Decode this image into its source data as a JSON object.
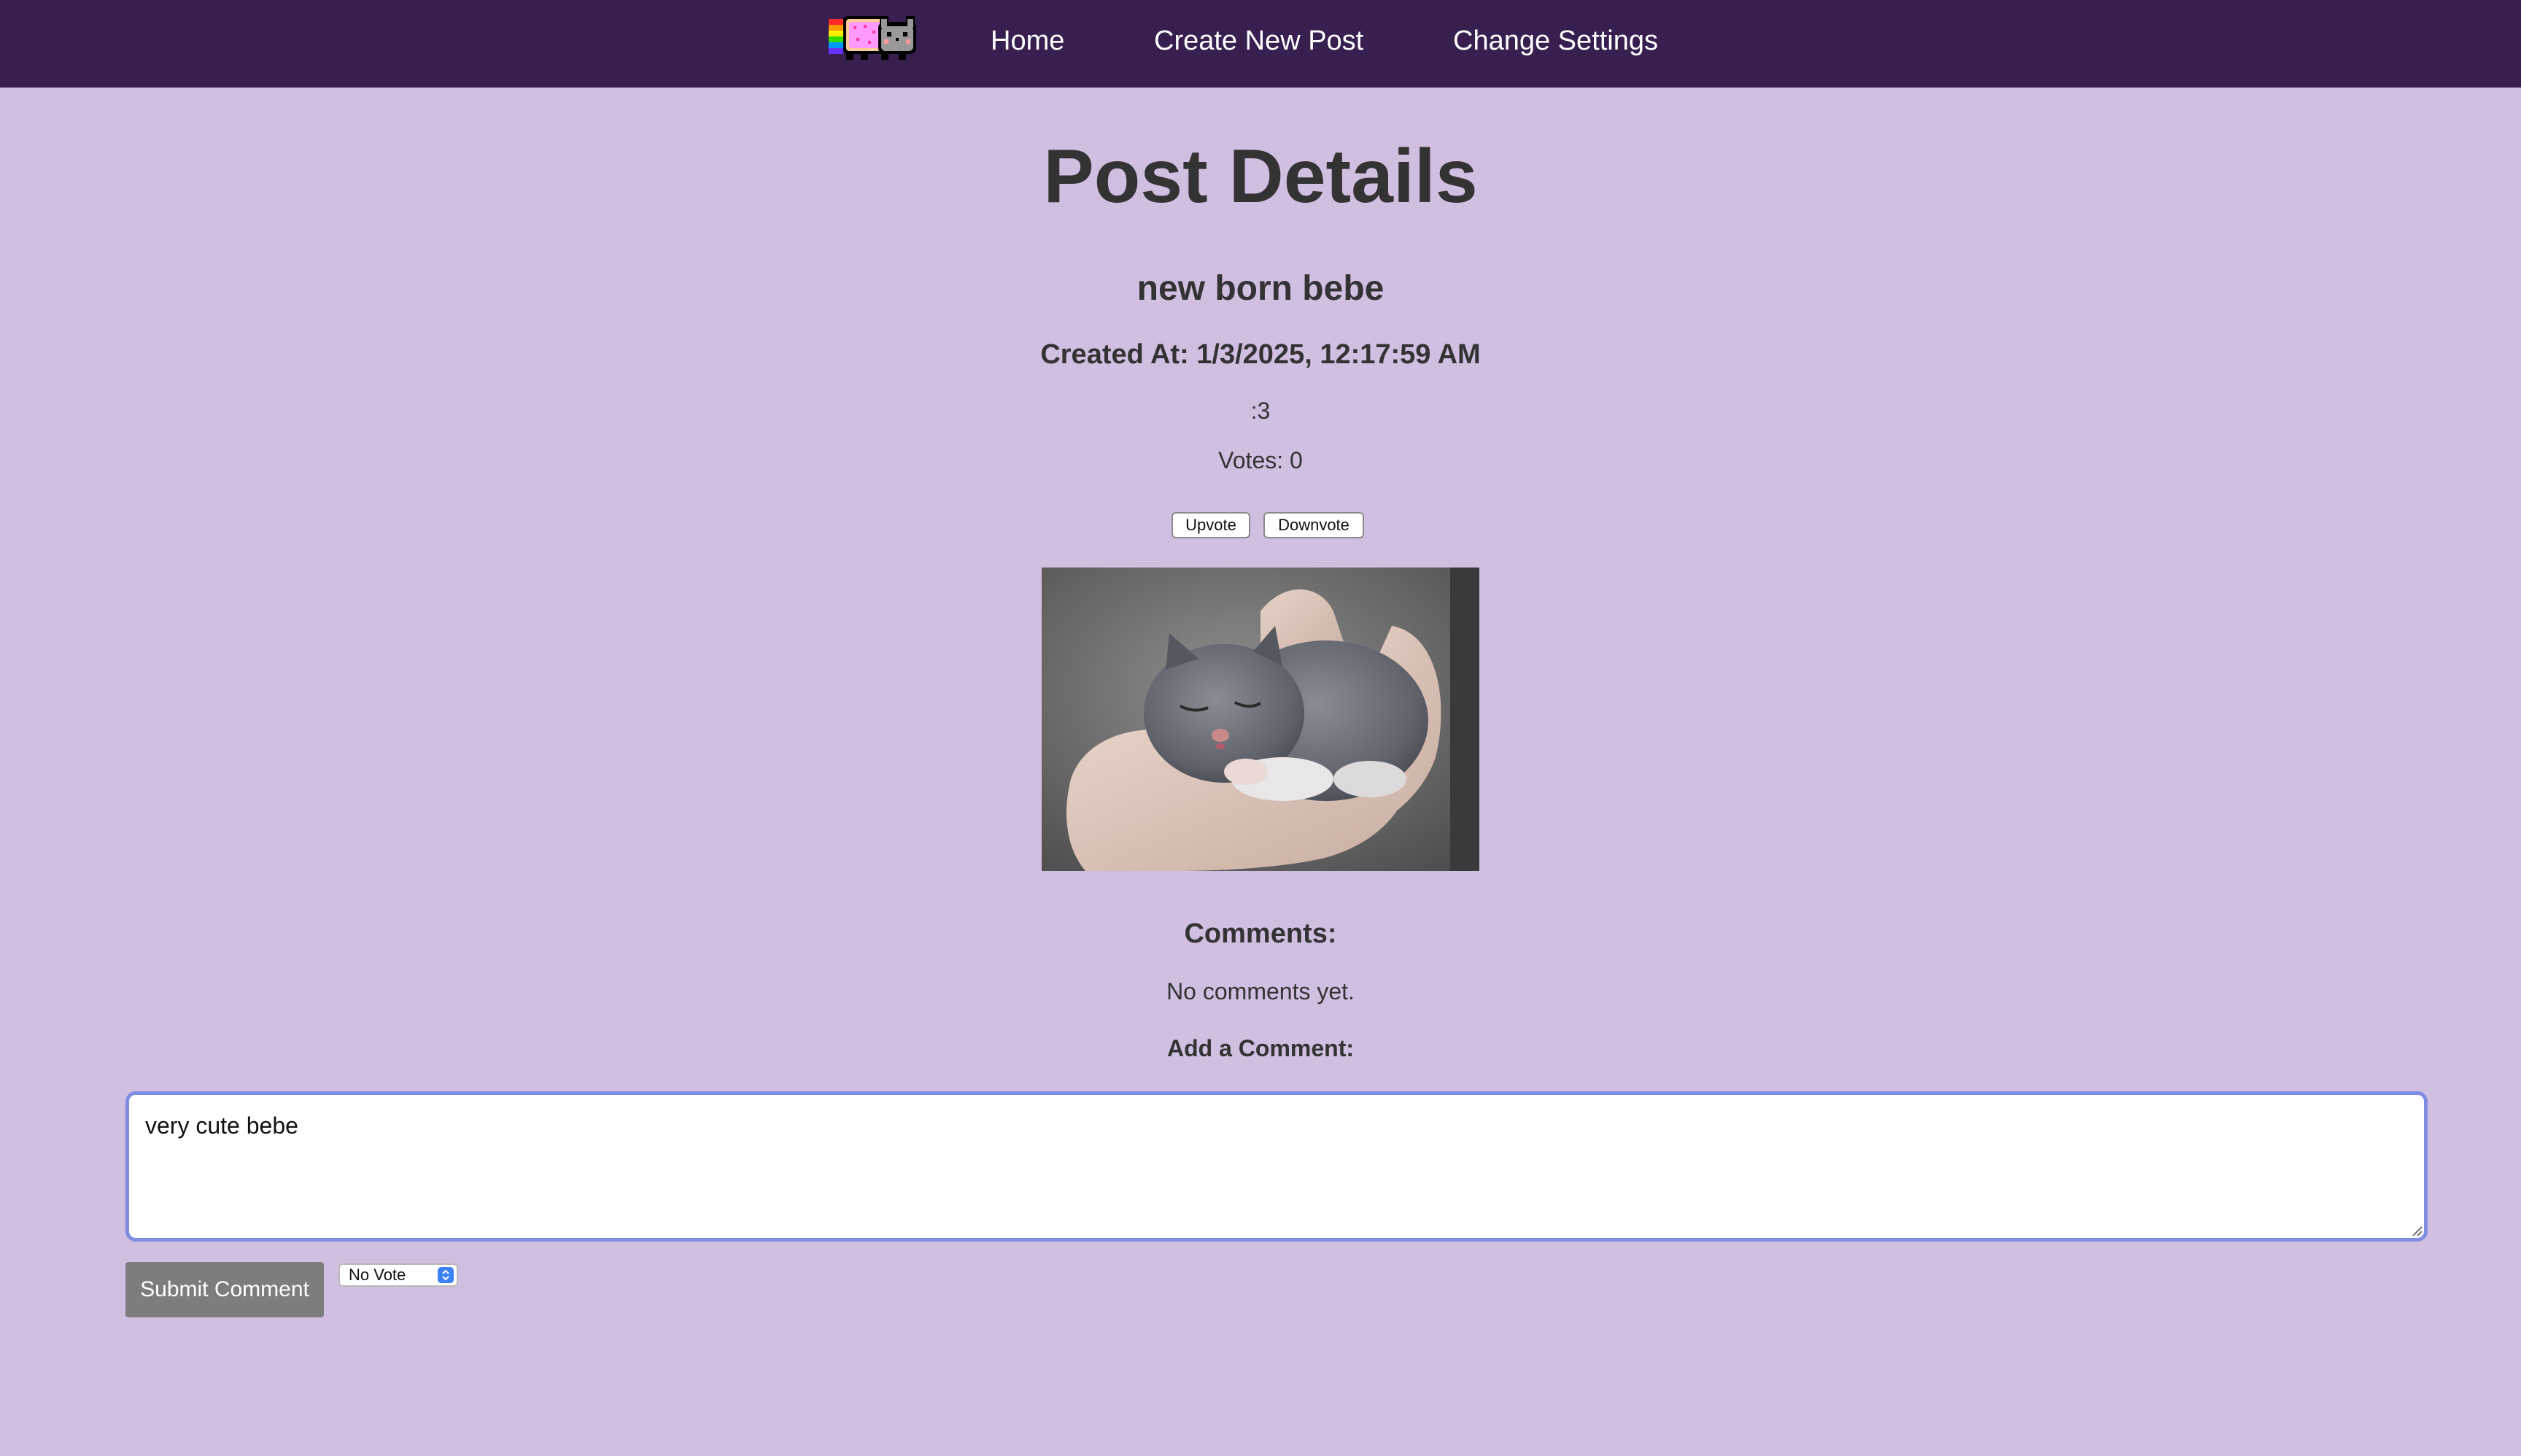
{
  "nav": {
    "logo_icon": "nyan-cat-icon",
    "items": [
      {
        "label": "Home"
      },
      {
        "label": "Create New Post"
      },
      {
        "label": "Change Settings"
      }
    ]
  },
  "page": {
    "title": "Post Details"
  },
  "post": {
    "title": "new born bebe",
    "created_at": "Created At: 1/3/2025, 12:17:59 AM",
    "content": ":3",
    "votes_text": "Votes: 0",
    "upvote_label": "Upvote",
    "downvote_label": "Downvote"
  },
  "comments": {
    "heading": "Comments:",
    "empty_text": "No comments yet.",
    "add_label": "Add a Comment:",
    "input_value": "very cute bebe",
    "submit_label": "Submit Comment",
    "vote_select_value": "No Vote"
  },
  "colors": {
    "nav_background": "#371f50",
    "page_background": "#d1bfe2",
    "text": "#333333",
    "focus_border": "#7f8ce2",
    "submit_button": "#7d7d7d",
    "select_accent": "#3b82f6"
  }
}
